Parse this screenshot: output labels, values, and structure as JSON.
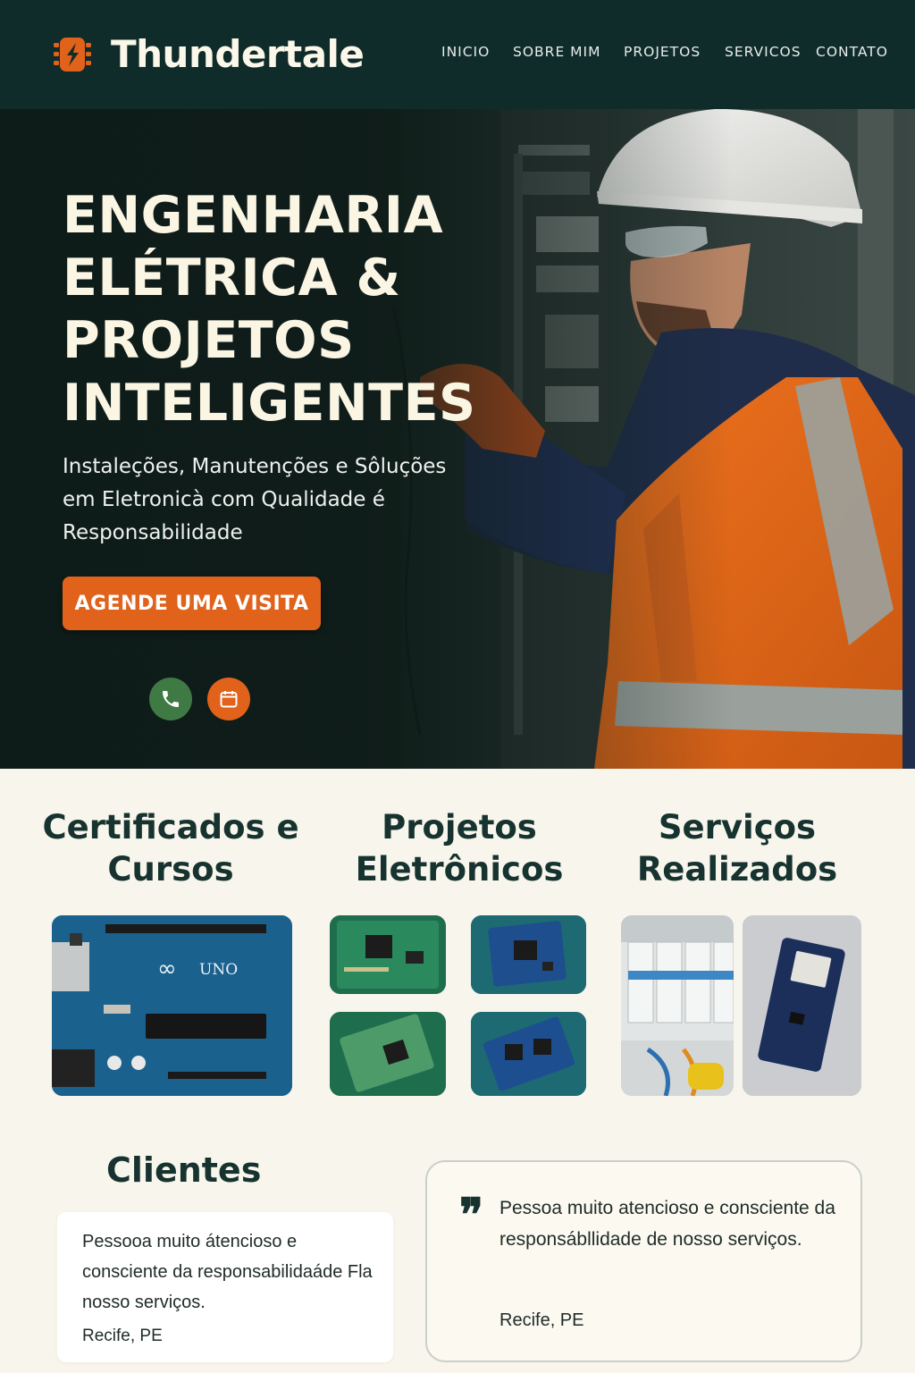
{
  "brand": {
    "name": "Thundertale",
    "accent": "#e0621b",
    "header_bg": "#0f2c2a",
    "page_bg": "#f8f6ec"
  },
  "nav": {
    "items": [
      "INICIO",
      "SOBRE MIM",
      "PROJETOS",
      "SERVICOS",
      "CONTATO"
    ]
  },
  "hero": {
    "title": "ENGENHARIA ELÉTRICA & PROJETOS INTELIGENTES",
    "subtitle": "Instaleções, Manutenções e Sôluções em Eletronicà com Qualidade é Responsabilidade",
    "cta_label": "AGENDE UMA VISITA",
    "buttons": {
      "phone_icon": "phone-icon",
      "calendar_icon": "calendar-icon"
    }
  },
  "sections": {
    "certificates": {
      "title": "Certificados e Cursos"
    },
    "projects": {
      "title": "Projetos Eletrônicos"
    },
    "services": {
      "title": "Serviços Realizados"
    }
  },
  "clients": {
    "title": "Clientes",
    "testimonial_left": {
      "quote": "Pessooa muito átencioso e consciente da responsabilidaáde Fla nosso serviços.",
      "location": "Recife, PE"
    },
    "testimonial_right": {
      "quote_mark": "❞",
      "quote": "Pessoa muito atencioso e consciente da responsábllidade de nosso serviços.",
      "location": "Recife, PE"
    }
  }
}
